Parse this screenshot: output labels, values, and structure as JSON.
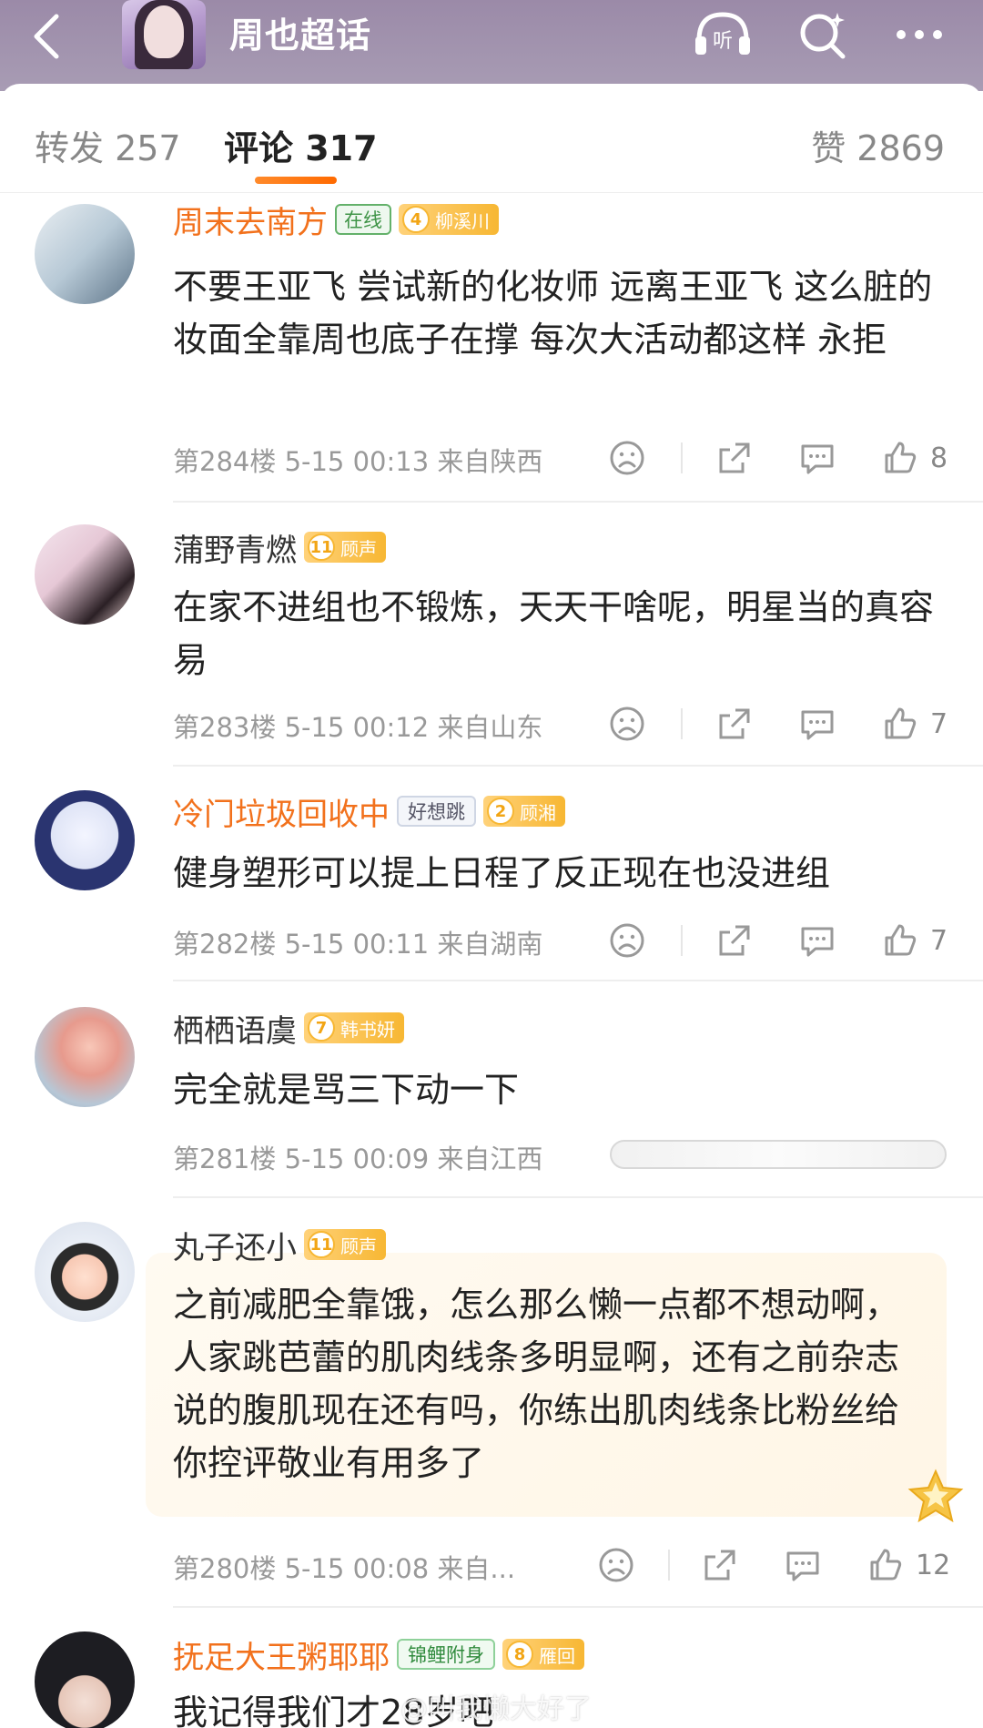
{
  "topbar": {
    "title": "周也超话",
    "icons": [
      "back-arrow-icon",
      "listen-icon",
      "search-icon",
      "more-icon"
    ],
    "listen_label": "听"
  },
  "tabs": {
    "repost": "转发 257",
    "comments": "评论 317",
    "likes": "赞 2869"
  },
  "comments": [
    {
      "name": "周末去南方",
      "badges": [
        {
          "type": "online",
          "text": "在线"
        },
        {
          "type": "gold",
          "level": "4",
          "text": "柳溪川"
        }
      ],
      "text": "不要王亚飞 尝试新的化妆师 远离王亚飞 这么脏的妆面全靠周也底子在撑 每次大活动都这样 永拒",
      "meta": "第284楼 5-15 00:13 来自陕西",
      "likes": "8"
    },
    {
      "name": "蒲野青燃",
      "badges": [
        {
          "type": "gold",
          "level": "11",
          "text": "顾声"
        }
      ],
      "text": "在家不进组也不锻炼，天天干啥呢，明星当的真容易",
      "meta": "第283楼 5-15 00:12 来自山东",
      "likes": "7"
    },
    {
      "name": "冷门垃圾回收中",
      "badges": [
        {
          "type": "plain",
          "text": "好想跳"
        },
        {
          "type": "gold",
          "level": "2",
          "text": "顾湘"
        }
      ],
      "text": "健身塑形可以提上日程了反正现在也没进组",
      "meta": "第282楼 5-15 00:11 来自湖南",
      "likes": "7"
    },
    {
      "name": "栖栖语虞",
      "badges": [
        {
          "type": "gold",
          "level": "7",
          "text": "韩书妍"
        }
      ],
      "text": "完全就是骂三下动一下",
      "meta": "第281楼 5-15 00:09 来自江西",
      "likes": ""
    },
    {
      "name": "丸子还小",
      "badges": [
        {
          "type": "gold",
          "level": "11",
          "text": "顾声"
        }
      ],
      "text": "之前减肥全靠饿，怎么那么懒一点都不想动啊，人家跳芭蕾的肌肉线条多明显啊，还有之前杂志说的腹肌现在还有吗，你练出肌肉线条比粉丝给你控评敬业有用多了",
      "meta": "第280楼 5-15 00:08 来自...",
      "likes": "12"
    },
    {
      "name": "抚足大王粥耶耶",
      "badges": [
        {
          "type": "green",
          "text": "锦鲤附身"
        },
        {
          "type": "gold",
          "level": "8",
          "text": "雁回"
        }
      ],
      "text": "我记得我们才28岁吧",
      "meta": "",
      "likes": ""
    }
  ],
  "watermark": "@叫我懒大好了",
  "colors": {
    "accent": "#f2711c",
    "gold_badge": "#f7b733",
    "topbar": "#9b8aa8"
  }
}
